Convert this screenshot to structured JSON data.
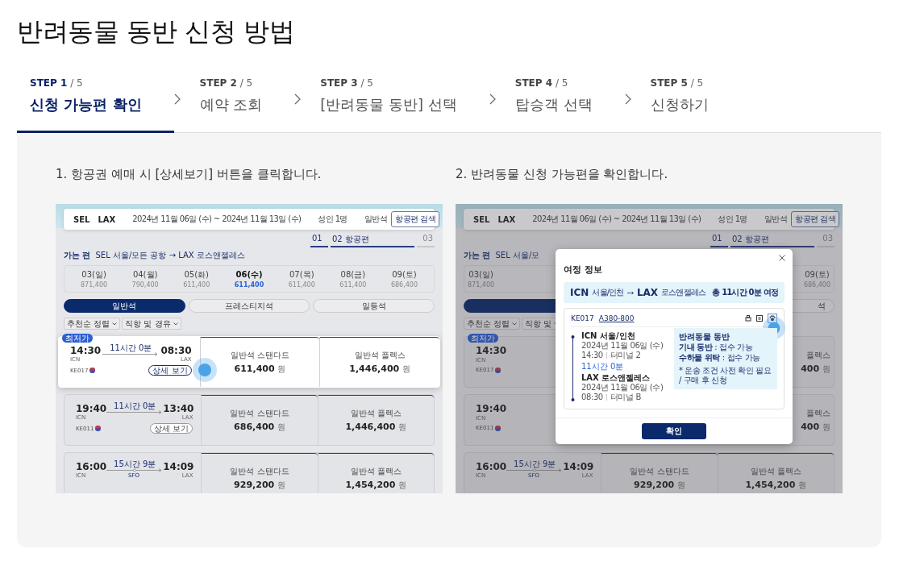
{
  "title": "반려동물 동반 신청 방법",
  "steps": [
    {
      "step": "STEP 1",
      "total": "/ 5",
      "label": "신청 가능편 확인",
      "selected": true
    },
    {
      "step": "STEP 2",
      "total": "/ 5",
      "label": "예약 조회",
      "selected": false
    },
    {
      "step": "STEP 3",
      "total": "/ 5",
      "label": "[반려동물 동반] 선택",
      "selected": false
    },
    {
      "step": "STEP 4",
      "total": "/ 5",
      "label": "탑승객 선택",
      "selected": false
    },
    {
      "step": "STEP 5",
      "total": "/ 5",
      "label": "신청하기",
      "selected": false
    }
  ],
  "guides": [
    {
      "caption": "1. 항공권 예매 시 [상세보기] 버튼을 클릭합니다.",
      "screen": {
        "dimmed": false,
        "search": {
          "origin": "SEL",
          "destination": "LAX",
          "dates": "2024년 11월 06일 (수) ~ 2024년 11월 13일 (수)",
          "passengers": "성인 1명",
          "cabin": "일반석",
          "button": "항공편 검색"
        },
        "progress": [
          {
            "label": "01",
            "active": true
          },
          {
            "label": "02 항공편",
            "active": true
          },
          {
            "label": "03",
            "active": false
          }
        ],
        "trip": {
          "label": "가는 편",
          "route": "SEL 서울/모든 공항 → LAX 로스앤젤레스"
        },
        "dates": [
          {
            "day": "03(일)",
            "fare": "871,400",
            "selected": false
          },
          {
            "day": "04(월)",
            "fare": "790,400",
            "selected": false
          },
          {
            "day": "05(화)",
            "fare": "611,400",
            "selected": false
          },
          {
            "day": "06(수)",
            "fare": "611,400",
            "selected": true
          },
          {
            "day": "07(목)",
            "fare": "611,400",
            "selected": false
          },
          {
            "day": "08(금)",
            "fare": "611,400",
            "selected": false
          },
          {
            "day": "09(토)",
            "fare": "686,400",
            "selected": false
          }
        ],
        "cabins": [
          {
            "label": "일반석",
            "selected": true
          },
          {
            "label": "프레스티지석",
            "selected": false
          },
          {
            "label": "일등석",
            "selected": false
          }
        ],
        "filters": [
          "추천순 정렬",
          "직항 및 경유"
        ],
        "flights": [
          {
            "kind": "full",
            "badge": "최저가",
            "highlighted": true,
            "depart_time": "14:30",
            "depart_airport": "ICN",
            "duration": "11시간 0분",
            "arrive_time": "08:30",
            "arrive_airport": "LAX",
            "flight_no": "KE017",
            "detail_button": "상세 보기",
            "tapped": true,
            "fares": [
              {
                "name": "일반석 스탠다드",
                "price": "611,400",
                "unit": "원"
              },
              {
                "name": "일반석 플렉스",
                "price": "1,446,400",
                "unit": "원"
              }
            ]
          },
          {
            "kind": "full",
            "highlighted": false,
            "depart_time": "19:40",
            "depart_airport": "ICN",
            "duration": "11시간 0분",
            "arrive_time": "13:40",
            "arrive_airport": "LAX",
            "flight_no": "KE011",
            "detail_button": "상세 보기",
            "tapped": false,
            "fares": [
              {
                "name": "일반석 스탠다드",
                "price": "686,400",
                "unit": "원"
              },
              {
                "name": "일반석 플렉스",
                "price": "1,446,400",
                "unit": "원"
              }
            ]
          },
          {
            "kind": "full",
            "highlighted": false,
            "depart_time": "16:00",
            "depart_airport": "ICN",
            "duration": "15시간 9분",
            "via": "SFO",
            "arrive_time": "14:09",
            "arrive_airport": "LAX",
            "fares": [
              {
                "name": "일반석 스탠다드",
                "price": "929,200",
                "unit": "원"
              },
              {
                "name": "일반석 플렉스",
                "price": "1,454,200",
                "unit": "원"
              }
            ]
          }
        ]
      }
    },
    {
      "caption": "2. 반려동물 신청 가능편을 확인합니다.",
      "screen": {
        "dimmed": true,
        "search": {
          "origin": "SEL",
          "destination": "LAX",
          "dates": "2024년 11월 06일 (수) ~ 2024년 11월 13일 (수)",
          "passengers": "성인 1명",
          "cabin": "일반석",
          "button": "항공편 검색"
        },
        "progress": [
          {
            "label": "01",
            "active": true
          },
          {
            "label": "02 항공편",
            "active": true
          },
          {
            "label": "03",
            "active": false
          }
        ],
        "trip": {
          "label": "가는 편",
          "route": "SEL 서울/모"
        },
        "dates": [
          {
            "day": "03(일)",
            "fare": "871,400",
            "selected": false
          },
          {
            "day": "09(토)",
            "fare": "686,400",
            "selected": false
          }
        ],
        "cabins": [
          {
            "selected": true
          },
          {
            "label": "석",
            "selected": false
          }
        ],
        "filters": [
          "추천순 정렬",
          "직항 및"
        ],
        "flights": [
          {
            "kind": "partial",
            "badge": "최저가",
            "depart_time": "14:30",
            "depart_airport": "ICN",
            "flight_no": "KE017",
            "fare_name": "플렉스",
            "fare_price": "400",
            "unit": "원"
          },
          {
            "kind": "partial",
            "depart_time": "19:40",
            "depart_airport": "ICN",
            "flight_no": "KE011",
            "fare_name": "플렉스",
            "fare_price": "400",
            "unit": "원"
          },
          {
            "kind": "full",
            "highlighted": false,
            "depart_time": "16:00",
            "depart_airport": "ICN",
            "duration": "15시간 9분",
            "via": "SFO",
            "arrive_time": "14:09",
            "arrive_airport": "LAX",
            "fares": [
              {
                "name": "일반석 스탠다드",
                "price": "929,200",
                "unit": "원"
              },
              {
                "name": "일반석 플렉스",
                "price": "1,454,200",
                "unit": "원"
              }
            ]
          }
        ],
        "modal": {
          "title": "여정 정보",
          "route": {
            "from_code": "ICN",
            "from_city": "서울/인천",
            "to_code": "LAX",
            "to_city": "로스앤젤레스",
            "total": "총 11시간 0분 여정"
          },
          "flight": {
            "number": "KE017",
            "aircraft": "A380-800",
            "pet_tapped": true,
            "duration": "11시간 0분",
            "segments": [
              {
                "airport": "ICN 서울/인천",
                "date": "2024년 11월 06일 (수)",
                "time": "14:30",
                "terminal": "터미널 2"
              },
              {
                "airport": "LAX 로스앤젤레스",
                "date": "2024년 11월 06일 (수)",
                "time": "08:30",
                "terminal": "터미널 B"
              }
            ]
          },
          "tooltip": {
            "title": "반려동물 동반",
            "lines": [
              "**기내 동반** : 접수 가능",
              "**수하물 위탁** : 접수 가능"
            ],
            "note": "* 운송 조건 사전 확인 필요 / 구매 후 신청"
          },
          "confirm": "확인"
        }
      }
    }
  ]
}
